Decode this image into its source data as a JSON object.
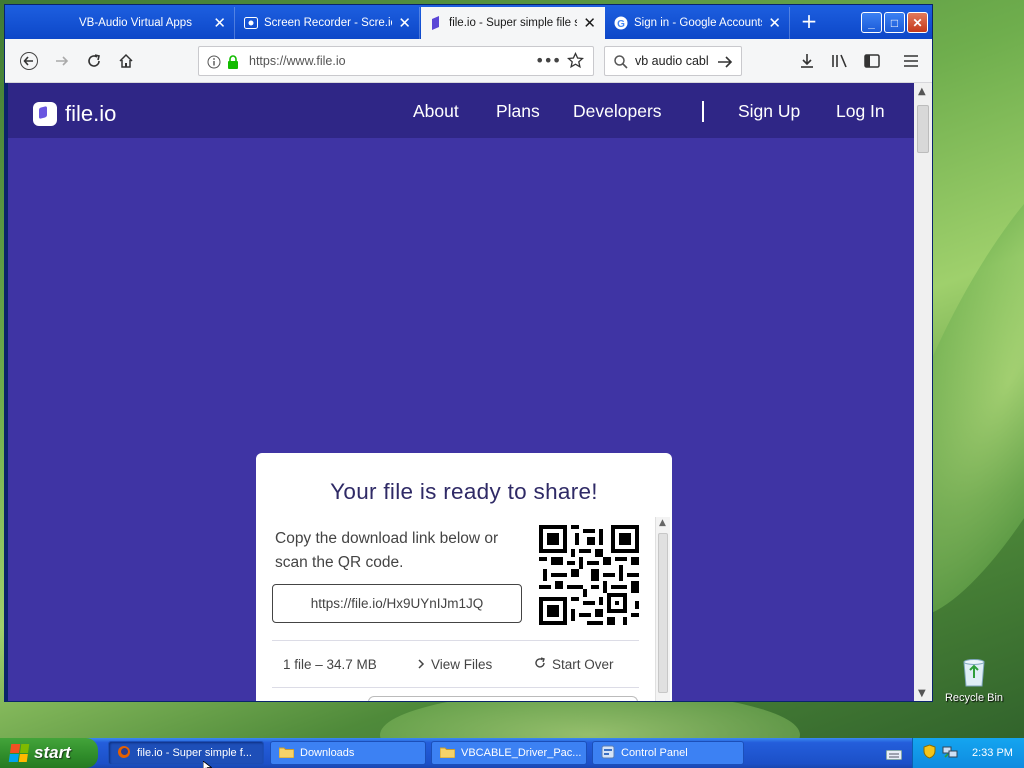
{
  "browser": {
    "tabs": [
      {
        "title": "VB-Audio Virtual Apps",
        "icon": "vb-audio-favicon",
        "active": false
      },
      {
        "title": "Screen Recorder - Scre.io",
        "icon": "screen-recorder-favicon",
        "active": false
      },
      {
        "title": "file.io - Super simple file sh",
        "icon": "fileio-favicon",
        "active": true
      },
      {
        "title": "Sign in - Google Accounts",
        "icon": "google-favicon",
        "active": false
      }
    ],
    "url": "https://www.file.io",
    "search_query": "vb audio cabl"
  },
  "site": {
    "logo_text": "file.io",
    "nav": {
      "about": "About",
      "plans": "Plans",
      "developers": "Developers",
      "signup": "Sign Up",
      "login": "Log In"
    },
    "card": {
      "title": "Your file is ready to share!",
      "description": "Copy the download link below or scan the QR code.",
      "share_link": "https://file.io/Hx9UYnIJm1JQ",
      "file_meta": "1 file – 34.7 MB",
      "view_files": "View Files",
      "start_over": "Start Over"
    }
  },
  "desktop": {
    "recycle_bin_label": "Recycle Bin"
  },
  "taskbar": {
    "start_label": "start",
    "tasks": [
      {
        "label": "file.io - Super simple f...",
        "icon": "firefox-icon",
        "active": true
      },
      {
        "label": "Downloads",
        "icon": "folder-icon",
        "active": false
      },
      {
        "label": "VBCABLE_Driver_Pac...",
        "icon": "folder-icon",
        "active": false
      },
      {
        "label": "Control Panel",
        "icon": "control-panel-icon",
        "active": false
      }
    ],
    "clock": "2:33 PM"
  },
  "colors": {
    "page_bg": "#3f34a4",
    "header_bg": "#2f2686",
    "title_color": "#2f2a66"
  }
}
